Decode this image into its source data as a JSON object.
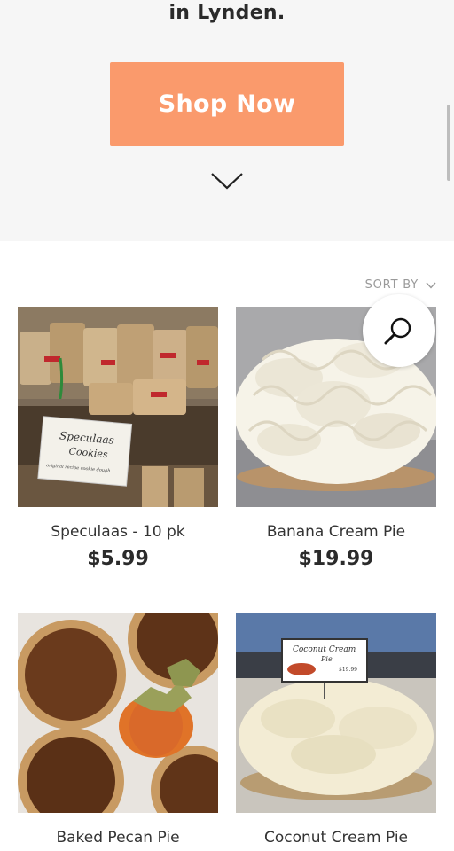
{
  "hero": {
    "text": "in Lynden.",
    "button_label": "Shop Now",
    "button_color": "#fa9a6c",
    "scroll_icon": "chevron-down-icon"
  },
  "sort": {
    "label": "SORT BY",
    "icon": "chevron-down-icon"
  },
  "search": {
    "icon": "search-icon"
  },
  "products": [
    {
      "name": "Speculaas - 10 pk",
      "price": "$5.99",
      "sign_line1": "Speculaas",
      "sign_line2": "Cookies",
      "sign_line3": "original recipe cookie dough"
    },
    {
      "name": "Banana Cream Pie",
      "price": "$19.99"
    },
    {
      "name": "Baked Pecan Pie"
    },
    {
      "name": "Coconut Cream Pie",
      "sign_line1": "Coconut Cream",
      "sign_line2": "Pie",
      "sign_price": "$19.99"
    }
  ]
}
